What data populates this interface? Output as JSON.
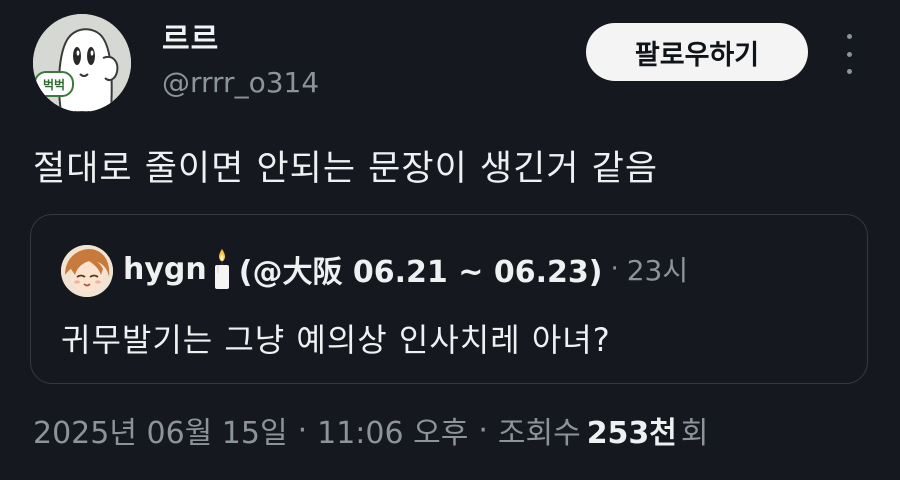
{
  "author": {
    "display_name": "르르",
    "handle": "@rrrr_o314",
    "avatar_text": "벅벅"
  },
  "actions": {
    "follow_label": "팔로우하기"
  },
  "post": {
    "text": "절대로 줄이면 안되는 문장이 생긴거 같음"
  },
  "quote": {
    "display_name": "hygn",
    "handle_suffix": "(@大阪 06.21 ~ 06.23)",
    "separator": "·",
    "time": "23시",
    "text": "귀무발기는 그냥 예의상 인사치레 아녀?"
  },
  "meta": {
    "date": "2025년 06월 15일",
    "separator": "·",
    "time": "11:06 오후",
    "views_label": "조회수",
    "views_count": "253천",
    "views_unit": "회"
  },
  "colors": {
    "background": "#15181e",
    "primary_text": "#eef0f1",
    "secondary_text": "#8b949b",
    "follow_button_bg": "#f4f4f4"
  }
}
